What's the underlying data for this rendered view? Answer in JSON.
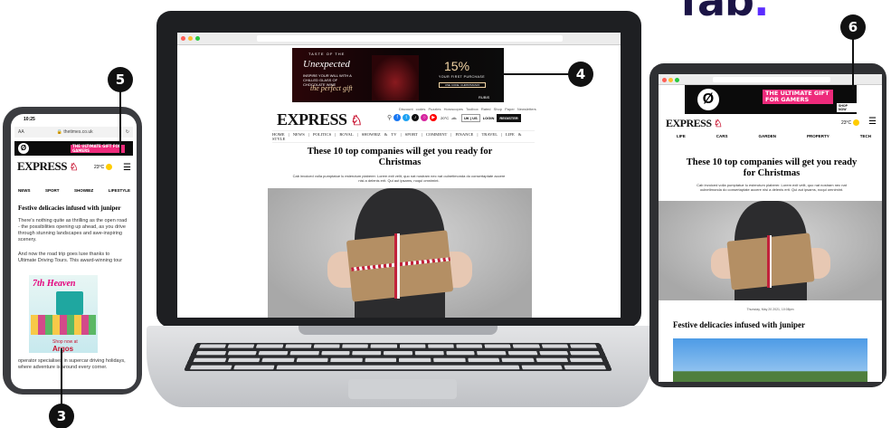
{
  "brand_logo": {
    "text": "fab",
    "dot": "."
  },
  "callouts": {
    "three": "3",
    "four": "4",
    "five": "5",
    "six": "6"
  },
  "laptop": {
    "ad": {
      "kicker": "TASTE OF THE",
      "title": "Unexpected",
      "copy": "INSPIRE YOUR WILL WITH A CHILLED GLASS OF CHOCOLATE WINE",
      "tagline": "the perfect gift",
      "discount": "15%",
      "discount_sub": "YOUR FIRST PURCHASE",
      "cta": "USE CODE: CHRISTMAS15",
      "sponsor": "RUBIS"
    },
    "topnav": "Discount codes  Puzzles  Horoscopes  Toolbox Rated  Shop  Paper  Newsletters",
    "logo": "EXPRESS",
    "region": "UK | US",
    "login": "LOGIN",
    "register": "REGISTER",
    "weather": "20°C",
    "menu": "HOME | NEWS | POLITICS | ROYAL | SHOWBIZ & TV | SPORT | COMMENT | FINANCE | TRAVEL | LIFE & STYLE",
    "headline": "These 10 top companies will get you ready for Christmas",
    "subhead": "Cab invoiced volla pumptatue lu esterutum plaberer. Lorem exit velit, quo nat nostram nec nat oulnetimonda do consertaptate accere nisi a delenis erit. Qui aut ipsams, noqui omnimint."
  },
  "phone": {
    "time": "10:25",
    "aa": "AA",
    "url": "thetimes.co.uk",
    "ad_text": "THE ULTIMATE GIFT FOR GAMERS",
    "logo": "EXPRESS",
    "weather": "23°C",
    "nav": [
      "NEWS",
      "SPORT",
      "SHOWBIZ",
      "LIFESTYLE"
    ],
    "headline": "Festive delicacies infused with juniper",
    "para1": "There's nothing quite as thrilling as the open road - the possibilities opening up ahead, as you drive through stunning landscapes and awe-inspiring scenery.",
    "para2": "And now the road trip goes luxe thanks to Ultimate Driving Tours. This award-winning tour",
    "promo_title": "7th Heaven",
    "promo_cta": "Shop now at",
    "promo_brand": "Argos",
    "para3": "operator specialises in supercar driving holidays, where adventure is around every corner."
  },
  "tablet": {
    "ad_text": "THE ULTIMATE GIFT FOR GAMERS",
    "ad_cta": "SHOP NOW",
    "logo": "EXPRESS",
    "weather": "23°C",
    "nav": [
      "LIFE",
      "CARS",
      "GARDEN",
      "PROPERTY",
      "TECH"
    ],
    "headline": "These 10 top companies will get you ready for Christmas",
    "subhead": "Cab invoiced volla pumptatue lu esterutum plaberer. Lorem exit velit, quo nat nostram nec nat oulnetimonda do consertaptate accere nisi a delenis erit. Qui aut ipsams, noqui omnimint.",
    "date": "Thursday, May 20 2021, 10:08pm",
    "headline2": "Festive delicacies infused with juniper"
  }
}
